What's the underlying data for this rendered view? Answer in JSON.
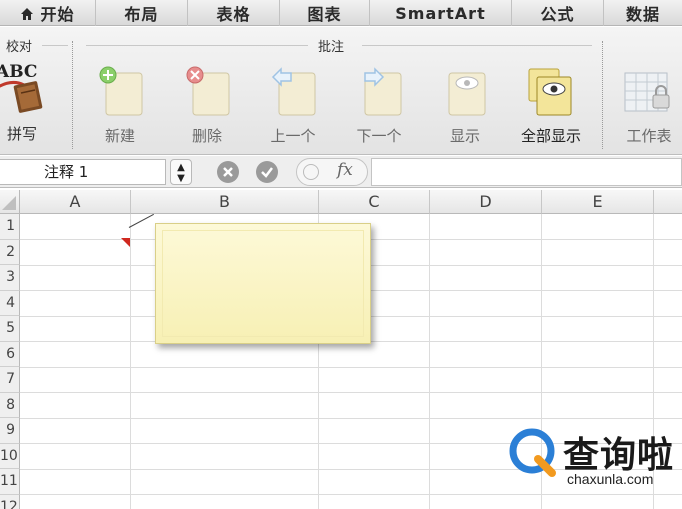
{
  "tabs": [
    {
      "label": "开始",
      "home": true
    },
    {
      "label": "布局"
    },
    {
      "label": "表格"
    },
    {
      "label": "图表"
    },
    {
      "label": "SmartArt"
    },
    {
      "label": "公式"
    },
    {
      "label": "数据"
    }
  ],
  "ribbon": {
    "proofing_group": "校对",
    "spelling_label": "拼写",
    "spelling_icon_text": "ABC",
    "comments_group": "批注",
    "buttons": {
      "new": "新建",
      "delete": "删除",
      "previous": "上一个",
      "next": "下一个",
      "show": "显示",
      "show_all": "全部显示",
      "worksheet": "工作表"
    }
  },
  "formula_bar": {
    "name_box": "注释 1",
    "fx_label": "fx",
    "formula": ""
  },
  "grid": {
    "columns": [
      "A",
      "B",
      "C",
      "D",
      "E"
    ],
    "rows": [
      "1",
      "2",
      "3",
      "4",
      "5",
      "6",
      "7",
      "8",
      "9",
      "10",
      "11",
      "12"
    ]
  },
  "comment": {
    "text": ""
  },
  "watermark": {
    "brand": "查询啦",
    "url": "chaxunla.com"
  },
  "colors": {
    "indicator": "#d0281f",
    "comment_fill": "#fbf5c7",
    "brand_blue": "#2b7fd6",
    "brand_orange": "#f29a1f"
  }
}
